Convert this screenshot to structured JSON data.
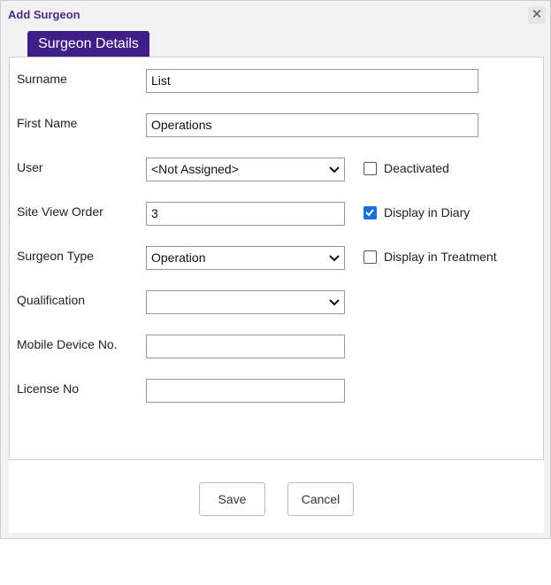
{
  "dialog": {
    "title": "Add Surgeon",
    "close_icon": "close-icon"
  },
  "tab": {
    "label": "Surgeon Details"
  },
  "form": {
    "surname": {
      "label": "Surname",
      "value": "List"
    },
    "first_name": {
      "label": "First Name",
      "value": "Operations"
    },
    "user": {
      "label": "User",
      "value": "<Not Assigned>"
    },
    "site_view_order": {
      "label": "Site View Order",
      "value": "3"
    },
    "surgeon_type": {
      "label": "Surgeon Type",
      "value": "Operation"
    },
    "qualification": {
      "label": "Qualification",
      "value": ""
    },
    "mobile_device_no": {
      "label": "Mobile Device No.",
      "value": ""
    },
    "license_no": {
      "label": "License No",
      "value": ""
    }
  },
  "checkboxes": {
    "deactivated": {
      "label": "Deactivated",
      "checked": false
    },
    "display_in_diary": {
      "label": "Display in Diary",
      "checked": true
    },
    "display_in_treatment": {
      "label": "Display in Treatment",
      "checked": false
    }
  },
  "buttons": {
    "save": "Save",
    "cancel": "Cancel"
  },
  "colors": {
    "accent": "#3d1f86",
    "title": "#4b2a8c",
    "checkbox": "#1a6fd8"
  }
}
